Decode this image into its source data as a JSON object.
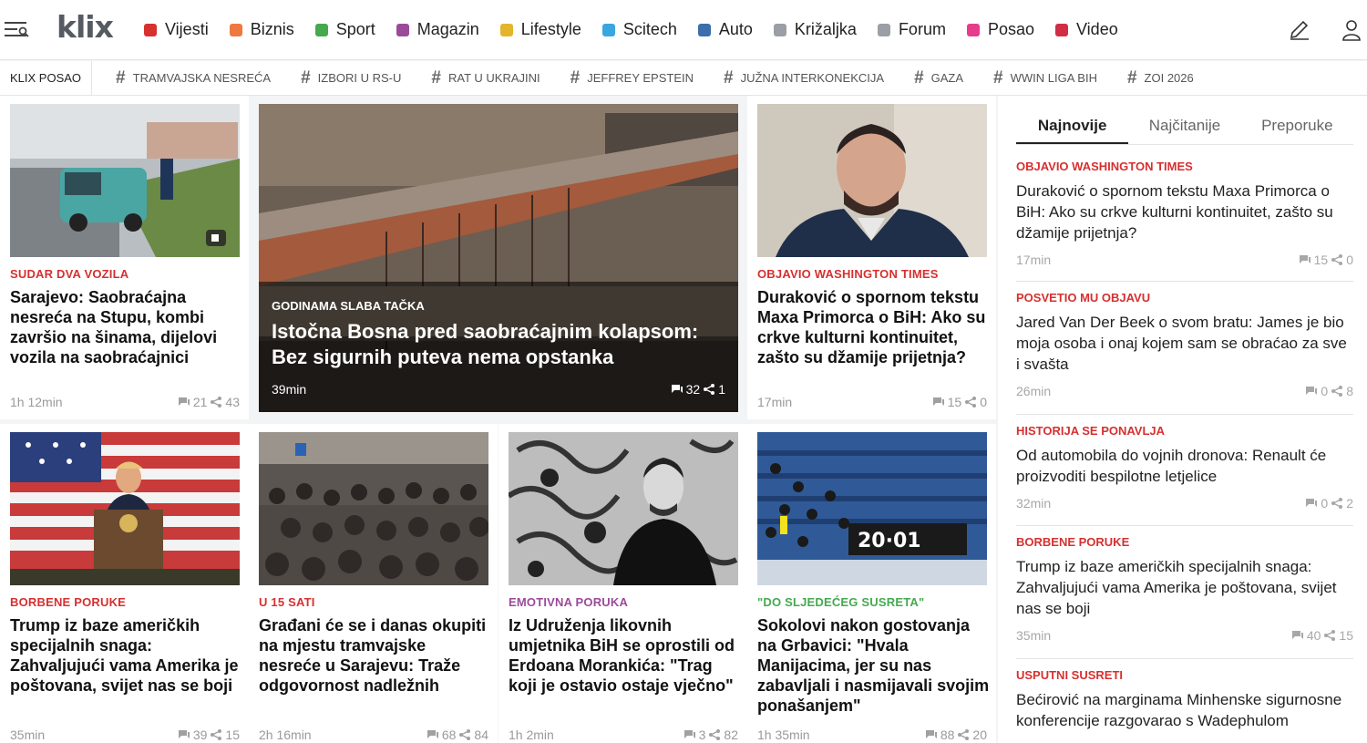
{
  "header": {
    "logo": "klix",
    "nav": [
      {
        "label": "Vijesti",
        "color": "#d6302f"
      },
      {
        "label": "Biznis",
        "color": "#ef7841"
      },
      {
        "label": "Sport",
        "color": "#45a94f"
      },
      {
        "label": "Magazin",
        "color": "#9b4a9a"
      },
      {
        "label": "Lifestyle",
        "color": "#e3b52b"
      },
      {
        "label": "Scitech",
        "color": "#3aa6e0"
      },
      {
        "label": "Auto",
        "color": "#3b6eab"
      },
      {
        "label": "Križaljka",
        "color": "#9b9fa5"
      },
      {
        "label": "Forum",
        "color": "#9b9fa5"
      },
      {
        "label": "Posao",
        "color": "#e73b8c"
      },
      {
        "label": "Video",
        "color": "#d12d45"
      }
    ]
  },
  "tags": {
    "first": "KLIX POSAO",
    "items": [
      "TRAMVAJSKA NESREĆA",
      "IZBORI U RS-U",
      "RAT U UKRAJINI",
      "JEFFREY EPSTEIN",
      "JUŽNA INTERKONEKCIJA",
      "GAZA",
      "WWIN LIGA BIH",
      "ZOI 2026"
    ]
  },
  "cards": {
    "c1": {
      "kicker": "SUDAR DVA VOZILA",
      "title": "Sarajevo: Saobraćajna nesreća na Stupu, kombi završio na šinama, dijelovi vozila na saobraćajnici",
      "time": "1h 12min",
      "comments": "21",
      "shares": "43"
    },
    "hero": {
      "kicker": "GODINAMA SLABA TAČKA",
      "title": "Istočna Bosna pred saobraćajnim kolapsom: Bez sigurnih puteva nema opstanka",
      "time": "39min",
      "comments": "32",
      "shares": "1"
    },
    "c3": {
      "kicker": "OBJAVIO WASHINGTON TIMES",
      "title": "Duraković o spornom tekstu Maxa Primorca o BiH: Ako su crkve kulturni kontinuitet, zašto su džamije prijetnja?",
      "time": "17min",
      "comments": "15",
      "shares": "0"
    },
    "c4": {
      "kicker": "BORBENE PORUKE",
      "title": "Trump iz baze američkih specijalnih snaga: Zahvaljujući vama Amerika je poštovana, svijet nas se boji",
      "time": "35min",
      "comments": "39",
      "shares": "15"
    },
    "c5": {
      "kicker": "U 15 SATI",
      "title": "Građani će se i danas okupiti na mjestu tramvajske nesreće u Sarajevu: Traže odgovornost nadležnih",
      "time": "2h 16min",
      "comments": "68",
      "shares": "84"
    },
    "c6": {
      "kicker": "EMOTIVNA PORUKA",
      "title": "Iz Udruženja likovnih umjetnika BiH se oprostili od Erdoana Morankića: \"Trag koji je ostavio ostaje vječno\"",
      "time": "1h 2min",
      "comments": "3",
      "shares": "82"
    },
    "c7": {
      "kicker": "\"DO SLJEDEĆEG SUSRETA\"",
      "title": "Sokolovi nakon gostovanja na Grbavici: \"Hvala Manijacima, jer su nas zabavljali i nasmijavali svojim ponašanjem\"",
      "time": "1h 35min",
      "comments": "88",
      "shares": "20"
    }
  },
  "colors": {
    "red": "#d6302f",
    "magenta": "#9b4a9a",
    "green": "#45a94f"
  },
  "sidebar": {
    "tabs": [
      "Najnovije",
      "Najčitanije",
      "Preporuke"
    ],
    "items": [
      {
        "kicker": "OBJAVIO WASHINGTON TIMES",
        "title": "Duraković o spornom tekstu Maxa Primorca o BiH: Ako su crkve kulturni kontinuitet, zašto su džamije prijetnja?",
        "time": "17min",
        "comments": "15",
        "shares": "0"
      },
      {
        "kicker": "POSVETIO MU OBJAVU",
        "title": "Jared Van Der Beek o svom bratu: James je bio moja osoba i onaj kojem sam se obraćao za sve i svašta",
        "time": "26min",
        "comments": "0",
        "shares": "8"
      },
      {
        "kicker": "HISTORIJA SE PONAVLJA",
        "title": "Od automobila do vojnih dronova: Renault će proizvoditi bespilotne letjelice",
        "time": "32min",
        "comments": "0",
        "shares": "2"
      },
      {
        "kicker": "BORBENE PORUKE",
        "title": "Trump iz baze američkih specijalnih snaga: Zahvaljujući vama Amerika je poštovana, svijet nas se boji",
        "time": "35min",
        "comments": "40",
        "shares": "15"
      },
      {
        "kicker": "USPUTNI SUSRETI",
        "title": "Bećirović na marginama Minhenske sigurnosne konferencije razgovarao s Wadephulom",
        "time": "",
        "comments": "",
        "shares": ""
      }
    ]
  }
}
